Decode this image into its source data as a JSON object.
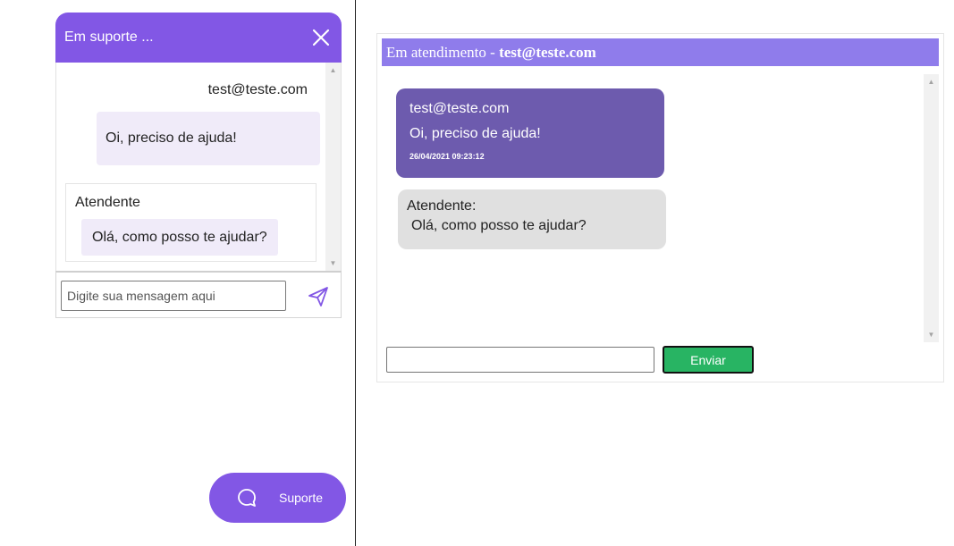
{
  "widget": {
    "title": "Em suporte ...",
    "messages": {
      "user_author": "test@teste.com",
      "user_text": "Oi, preciso de ajuda!",
      "agent_author": "Atendente",
      "agent_text": "Olá, como posso te ajudar?"
    },
    "input_placeholder": "Digite sua mensagem aqui",
    "fab_label": "Suporte",
    "accent_color": "#8257e5"
  },
  "panel": {
    "title_prefix": "Em atendimento - ",
    "title_email": "test@teste.com",
    "header_color": "#8f7ceb",
    "messages": {
      "user_email": "test@teste.com",
      "user_text": "Oi, preciso de ajuda!",
      "user_time": "26/04/2021 09:23:12",
      "agent_label": "Atendente:",
      "agent_text": "Olá, como posso te ajudar?"
    },
    "send_label": "Enviar",
    "send_color": "#28b463"
  },
  "icons": [
    "close-icon",
    "send-icon",
    "chat-icon",
    "scroll-up-icon",
    "scroll-down-icon"
  ]
}
